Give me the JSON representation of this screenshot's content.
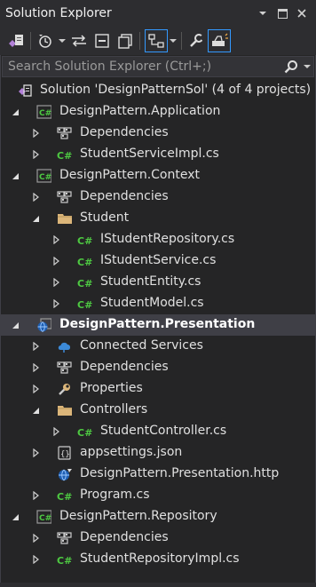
{
  "window": {
    "title": "Solution Explorer"
  },
  "search": {
    "placeholder": "Search Solution Explorer (Ctrl+;)"
  },
  "tree": [
    {
      "label": "Solution 'DesignPatternSol' (4 of 4 projects)",
      "level": 0,
      "icon": "solution-icon",
      "expander": "none"
    },
    {
      "label": "DesignPattern.Application",
      "level": 0,
      "icon": "csharp-project-icon",
      "expander": "expanded"
    },
    {
      "label": "Dependencies",
      "level": 1,
      "icon": "dependencies-icon",
      "expander": "collapsed"
    },
    {
      "label": "StudentServiceImpl.cs",
      "level": 1,
      "icon": "csharp-file-icon",
      "expander": "collapsed"
    },
    {
      "label": "DesignPattern.Context",
      "level": 0,
      "icon": "csharp-project-icon",
      "expander": "expanded"
    },
    {
      "label": "Dependencies",
      "level": 1,
      "icon": "dependencies-icon",
      "expander": "collapsed"
    },
    {
      "label": "Student",
      "level": 1,
      "icon": "folder-icon",
      "expander": "expanded"
    },
    {
      "label": "IStudentRepository.cs",
      "level": 2,
      "icon": "csharp-file-icon",
      "expander": "collapsed"
    },
    {
      "label": "IStudentService.cs",
      "level": 2,
      "icon": "csharp-file-icon",
      "expander": "collapsed"
    },
    {
      "label": "StudentEntity.cs",
      "level": 2,
      "icon": "csharp-file-icon",
      "expander": "collapsed"
    },
    {
      "label": "StudentModel.cs",
      "level": 2,
      "icon": "csharp-file-icon",
      "expander": "collapsed"
    },
    {
      "label": "DesignPattern.Presentation",
      "level": 0,
      "icon": "web-project-icon",
      "expander": "expanded",
      "bold": true,
      "selected": true
    },
    {
      "label": "Connected Services",
      "level": 1,
      "icon": "connected-services-icon",
      "expander": "collapsed"
    },
    {
      "label": "Dependencies",
      "level": 1,
      "icon": "dependencies-icon",
      "expander": "collapsed"
    },
    {
      "label": "Properties",
      "level": 1,
      "icon": "properties-icon",
      "expander": "collapsed"
    },
    {
      "label": "Controllers",
      "level": 1,
      "icon": "folder-icon",
      "expander": "expanded"
    },
    {
      "label": "StudentController.cs",
      "level": 2,
      "icon": "csharp-file-icon",
      "expander": "collapsed"
    },
    {
      "label": "appsettings.json",
      "level": 1,
      "icon": "json-file-icon",
      "expander": "collapsed"
    },
    {
      "label": "DesignPattern.Presentation.http",
      "level": 1,
      "icon": "http-file-icon",
      "expander": "none"
    },
    {
      "label": "Program.cs",
      "level": 1,
      "icon": "csharp-file-icon",
      "expander": "collapsed"
    },
    {
      "label": "DesignPattern.Repository",
      "level": 0,
      "icon": "csharp-project-icon",
      "expander": "expanded"
    },
    {
      "label": "Dependencies",
      "level": 1,
      "icon": "dependencies-icon",
      "expander": "collapsed"
    },
    {
      "label": "StudentRepositoryImpl.cs",
      "level": 1,
      "icon": "csharp-file-icon",
      "expander": "collapsed"
    }
  ],
  "colors": {
    "background": "#252526",
    "toolbar": "#2d2d30",
    "selection": "#3f3f46",
    "csharp_green": "#4ec942",
    "folder": "#dcb67a"
  }
}
